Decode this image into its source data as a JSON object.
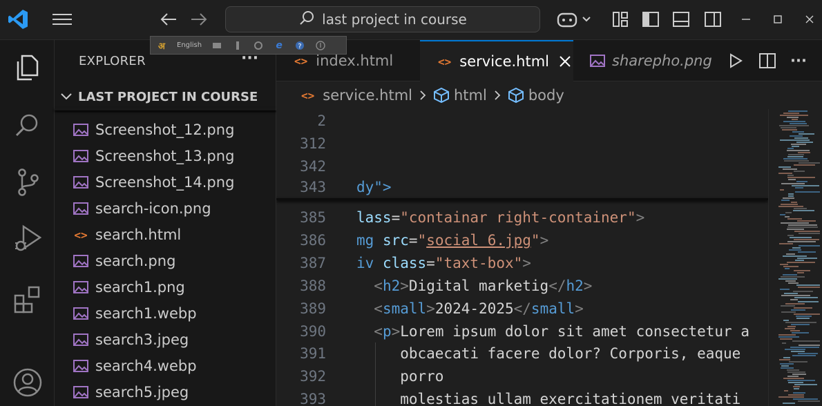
{
  "titlebar": {
    "search_placeholder": "last project in course"
  },
  "langbar": {
    "language": "English"
  },
  "sidebar": {
    "title": "EXPLORER",
    "more": "···",
    "folder": "LAST PROJECT IN COURSE",
    "files": [
      {
        "name": "Screenshot_12.png",
        "type": "image"
      },
      {
        "name": "Screenshot_13.png",
        "type": "image"
      },
      {
        "name": "Screenshot_14.png",
        "type": "image"
      },
      {
        "name": "search-icon.png",
        "type": "image"
      },
      {
        "name": "search.html",
        "type": "html"
      },
      {
        "name": "search.png",
        "type": "image"
      },
      {
        "name": "search1.png",
        "type": "image"
      },
      {
        "name": "search1.webp",
        "type": "image"
      },
      {
        "name": "search3.jpeg",
        "type": "image"
      },
      {
        "name": "search4.webp",
        "type": "image"
      },
      {
        "name": "search5.jpeg",
        "type": "image"
      }
    ]
  },
  "tabs": {
    "items": [
      {
        "label": "index.html",
        "type": "html"
      },
      {
        "label": "service.html",
        "type": "html",
        "active": true
      },
      {
        "label": "sharepho.png",
        "type": "image"
      }
    ]
  },
  "breadcrumb": {
    "items": [
      "service.html",
      "html",
      "body"
    ]
  },
  "editor": {
    "sticky_lines": [
      {
        "num": "2",
        "code": ""
      },
      {
        "num": "312",
        "code": ""
      },
      {
        "num": "342",
        "code": ""
      },
      {
        "num": "343",
        "code": "dy\">"
      }
    ],
    "lines": [
      {
        "num": "385"
      },
      {
        "num": "386"
      },
      {
        "num": "387"
      },
      {
        "num": "388"
      },
      {
        "num": "389"
      },
      {
        "num": "390"
      },
      {
        "num": "391"
      },
      {
        "num": "392"
      },
      {
        "num": "393"
      }
    ]
  },
  "colors": {
    "accent": "#0078d4",
    "tag": "#569cd6",
    "attr": "#9cdcfe",
    "string": "#ce9178",
    "html_icon": "#e37933",
    "image_icon": "#a074c4"
  }
}
